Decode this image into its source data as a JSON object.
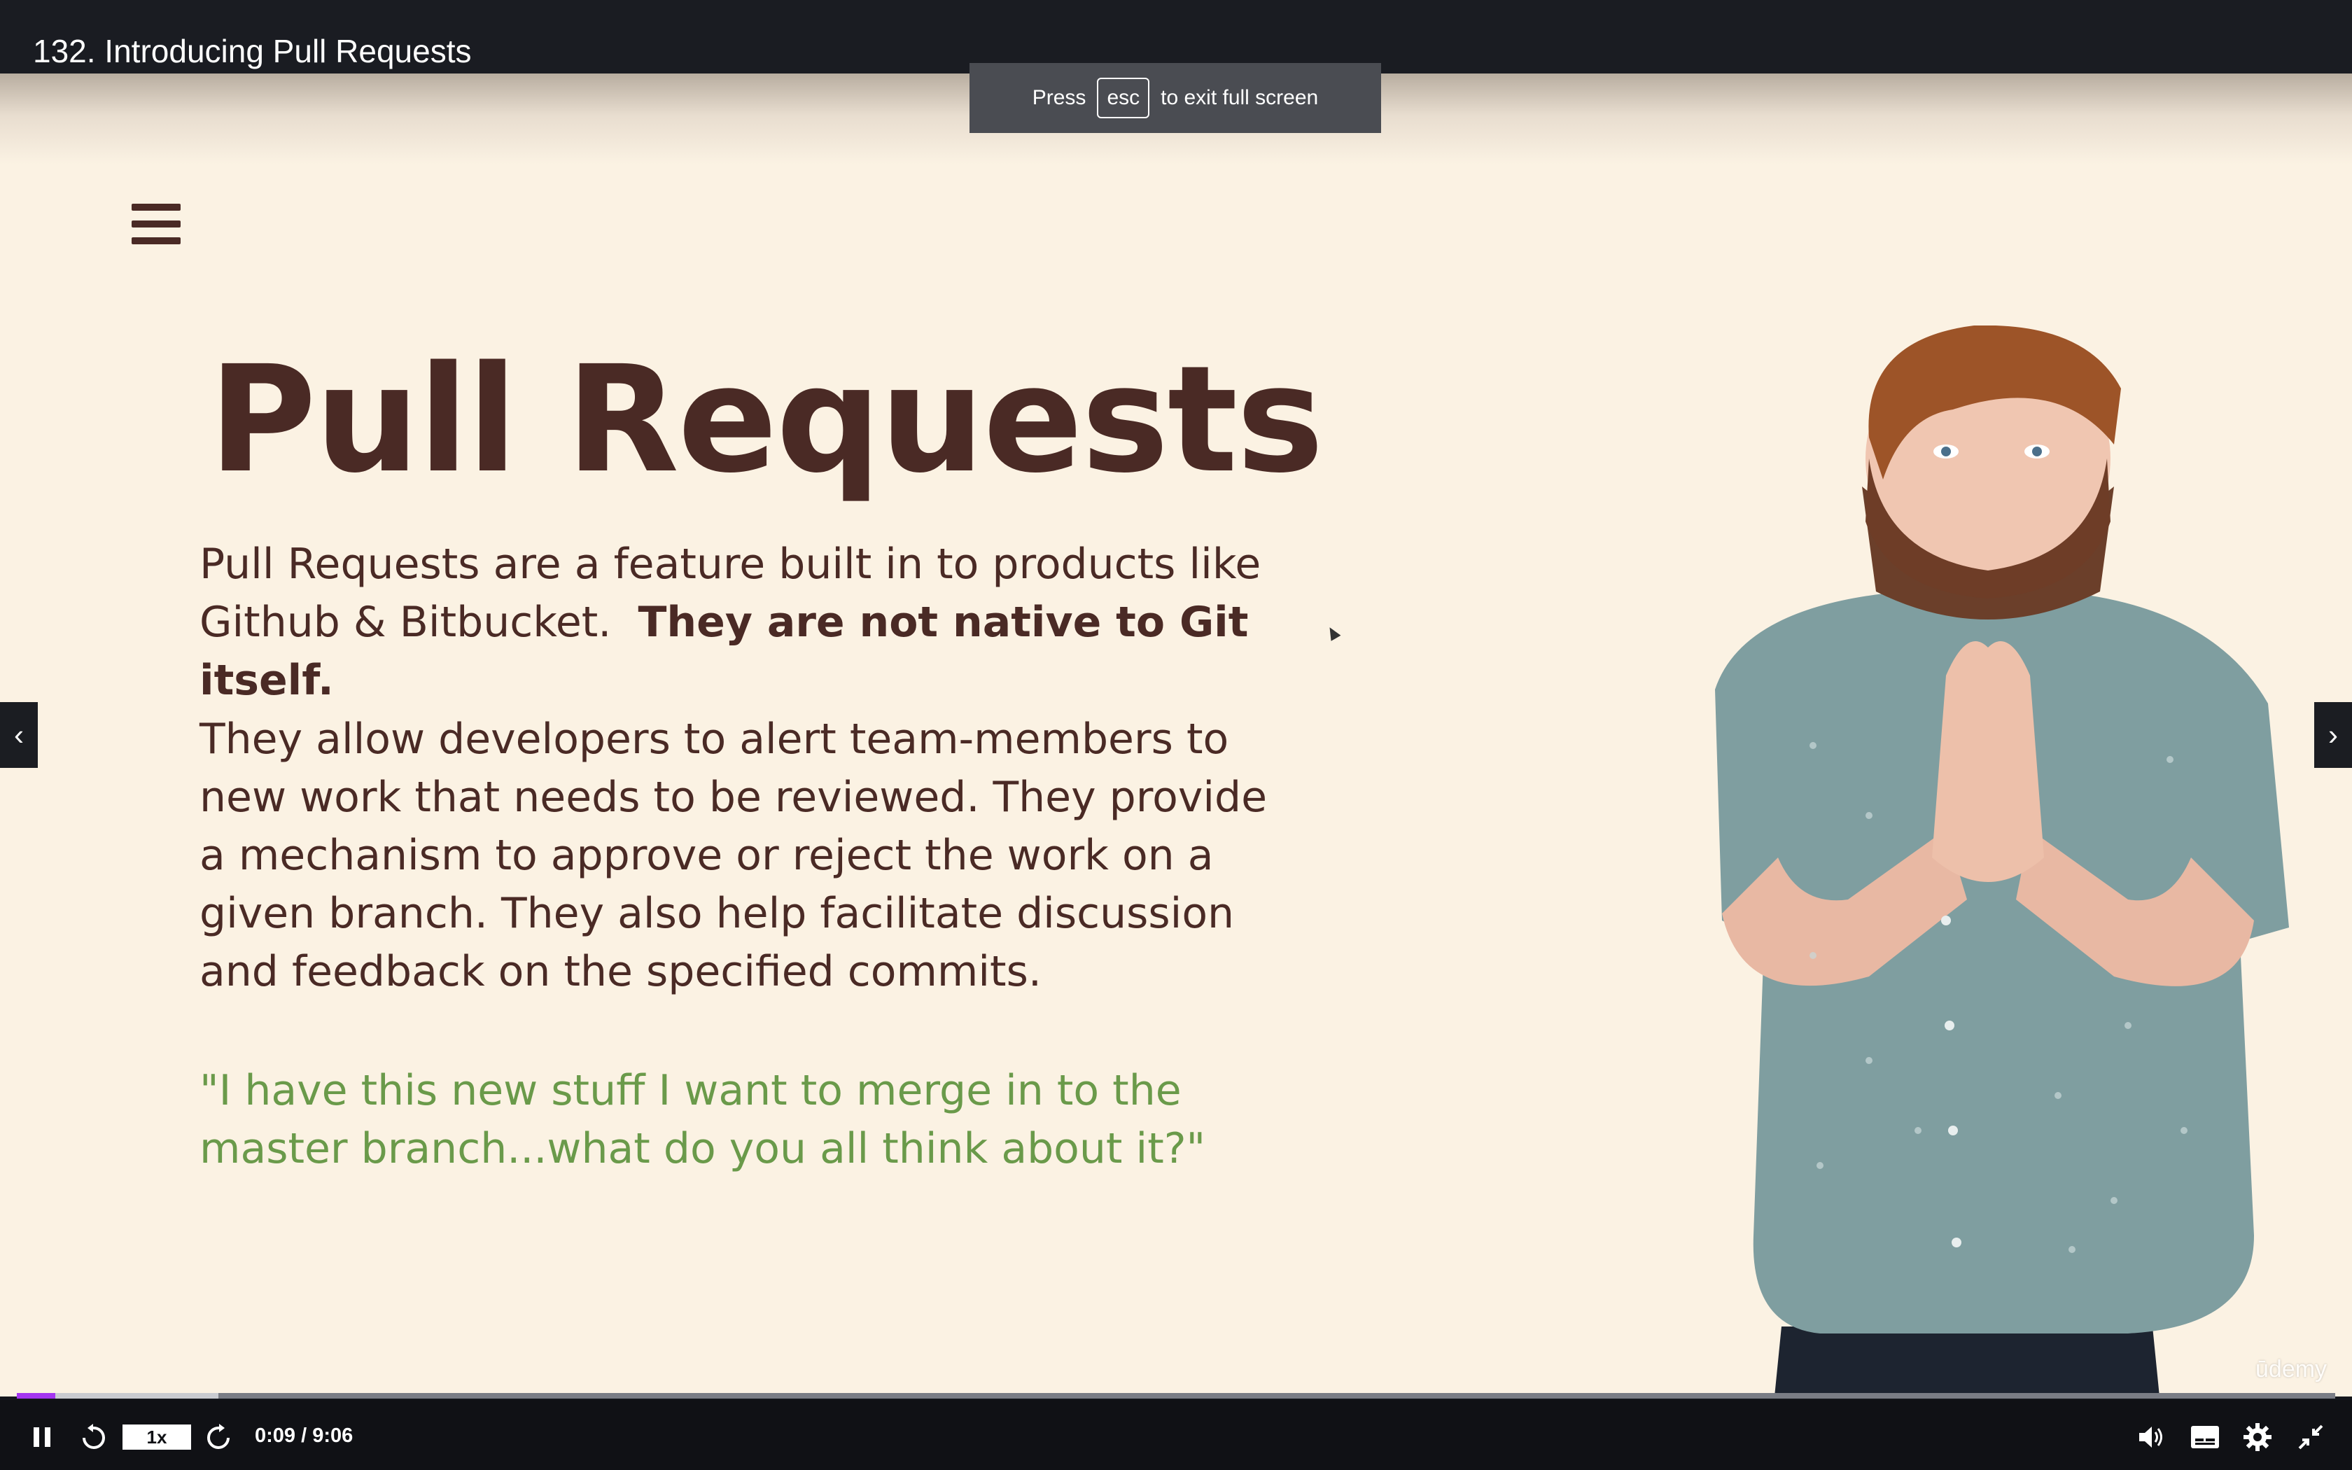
{
  "lecture": {
    "title": "132. Introducing Pull Requests"
  },
  "toast": {
    "prefix": "Press",
    "key": "esc",
    "suffix": "to exit full screen"
  },
  "slide": {
    "title": "Pull Requests",
    "para1_plain": "Pull Requests are a feature built in to products like Github & Bitbucket.",
    "para1_bold": "They are not native to Git itself.",
    "para2": "They allow developers to alert team-members to new work that needs to be reviewed.  They provide a mechanism to approve or reject the work on a given branch.  They also help facilitate discussion and feedback on the specified commits.",
    "quote": "\"I have this new stuff I want to merge in to the master branch...what do you all think about it?\""
  },
  "watermark": "ūdemy",
  "player": {
    "speed": "1x",
    "time": "0:09 / 9:06",
    "progress_fraction": 0.0166,
    "buffered_fraction": 0.087,
    "accent": "#a435f0"
  },
  "icons": {
    "menu": "hamburger-icon",
    "prev": "chevron-left-icon",
    "next": "chevron-right-icon",
    "pause": "pause-icon",
    "rewind": "rewind-5-icon",
    "forward": "forward-5-icon",
    "volume": "volume-icon",
    "captions": "captions-icon",
    "settings": "gear-icon",
    "exit_fullscreen": "exit-fullscreen-icon"
  }
}
